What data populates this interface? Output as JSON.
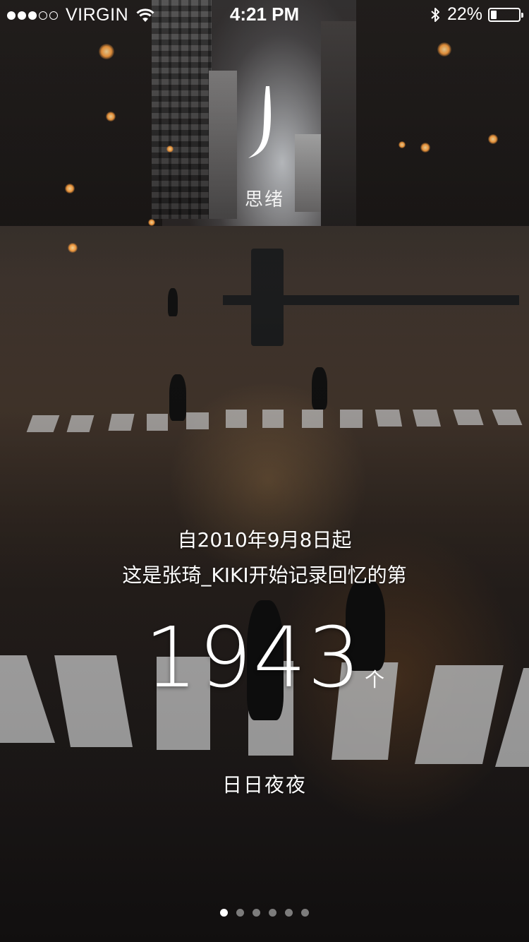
{
  "status_bar": {
    "signal_dots_filled": 3,
    "signal_dots_total": 5,
    "carrier": "VIRGIN",
    "time": "4:21 PM",
    "battery_text": "22%",
    "battery_level": 0.22,
    "icons": [
      "wifi-icon",
      "bluetooth-icon",
      "battery-icon"
    ]
  },
  "app": {
    "logo_letter": "J",
    "name": "思绪"
  },
  "main": {
    "line1": "自2010年9月8日起",
    "line2": "这是张琦_KIKI开始记录回忆的第",
    "count": "1943",
    "unit": "个",
    "line3": "日日夜夜"
  },
  "pager": {
    "pages": 6,
    "active_index": 0
  },
  "colors": {
    "text": "#ffffff",
    "page_dot_inactive": "rgba(255,255,255,0.45)"
  }
}
